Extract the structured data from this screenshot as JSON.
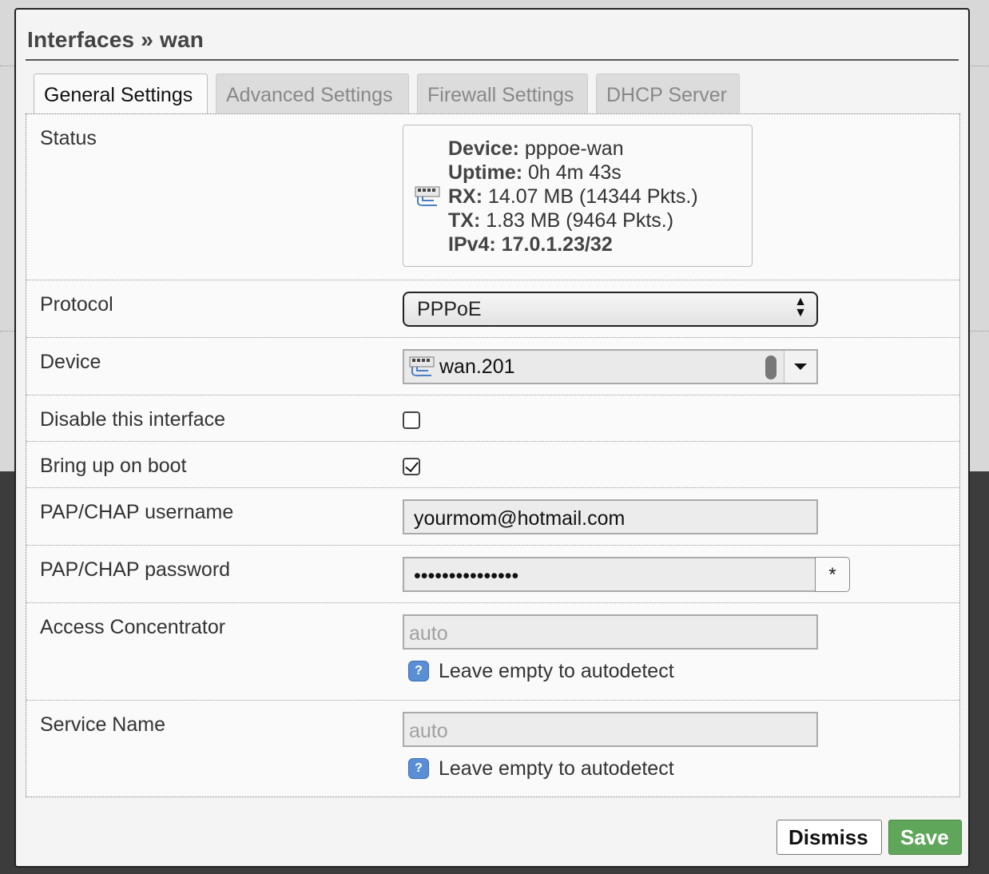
{
  "dialog": {
    "title": "Interfaces » wan"
  },
  "tabs": [
    {
      "label": "General Settings",
      "active": true
    },
    {
      "label": "Advanced Settings",
      "active": false
    },
    {
      "label": "Firewall Settings",
      "active": false
    },
    {
      "label": "DHCP Server",
      "active": false
    }
  ],
  "status": {
    "label": "Status",
    "device_key": "Device:",
    "device_val": " pppoe-wan",
    "uptime_key": "Uptime:",
    "uptime_val": " 0h 4m 43s",
    "rx_key": "RX:",
    "rx_val": " 14.07 MB (14344 Pkts.)",
    "tx_key": "TX:",
    "tx_val": " 1.83 MB (9464 Pkts.)",
    "ipv4_key": "IPv4:",
    "ipv4_val": " 17.0.1.23/32",
    "icon": "network-port-icon"
  },
  "protocol": {
    "label": "Protocol",
    "value": "PPPoE"
  },
  "device": {
    "label": "Device",
    "value": "wan.201",
    "icon": "network-port-icon"
  },
  "disable_interface": {
    "label": "Disable this interface",
    "checked": false
  },
  "bring_up_on_boot": {
    "label": "Bring up on boot",
    "checked": true
  },
  "username": {
    "label": "PAP/CHAP username",
    "value": "yourmom@hotmail.com"
  },
  "password": {
    "label": "PAP/CHAP password",
    "value": "•••••••••••••••",
    "toggle": "*"
  },
  "access_concentrator": {
    "label": "Access Concentrator",
    "placeholder": "auto",
    "help": "Leave empty to autodetect"
  },
  "service_name": {
    "label": "Service Name",
    "placeholder": "auto",
    "help": "Leave empty to autodetect"
  },
  "buttons": {
    "dismiss": "Dismiss",
    "save": "Save"
  },
  "colors": {
    "save": "#5fa55a",
    "help_icon": "#5a8fd6"
  }
}
